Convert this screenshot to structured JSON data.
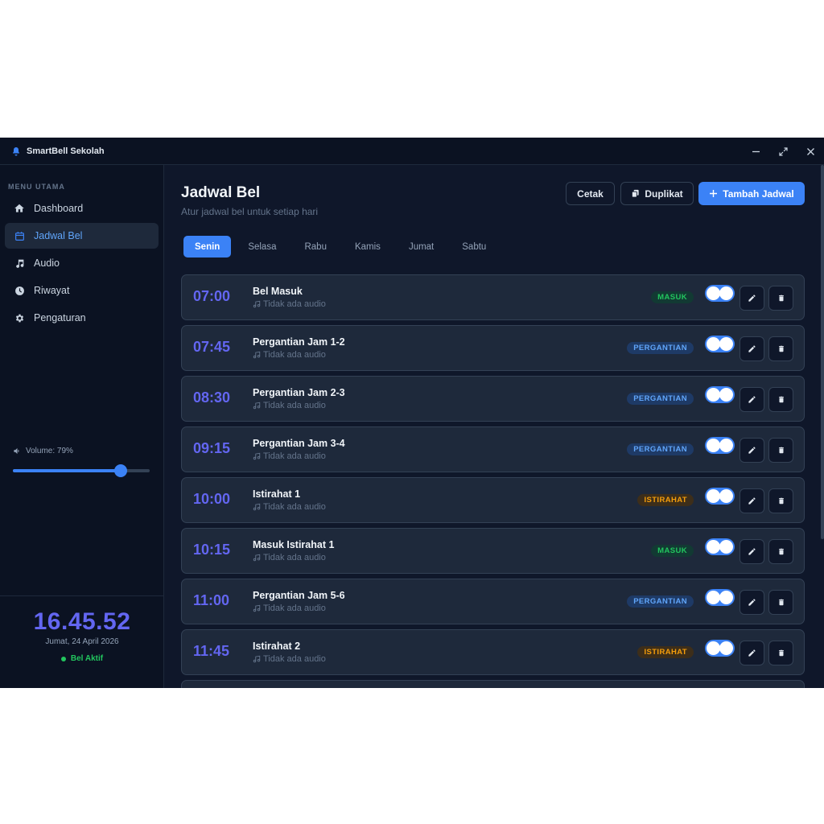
{
  "app": {
    "title": "SmartBell Sekolah"
  },
  "sidebar": {
    "heading": "MENU UTAMA",
    "items": [
      {
        "label": "Dashboard",
        "icon": "home-icon"
      },
      {
        "label": "Jadwal Bel",
        "icon": "calendar-icon",
        "active": true
      },
      {
        "label": "Audio",
        "icon": "music-icon"
      },
      {
        "label": "Riwayat",
        "icon": "clock-icon"
      },
      {
        "label": "Pengaturan",
        "icon": "gear-icon"
      }
    ],
    "volume": {
      "label": "Volume: 79%",
      "value": 79
    },
    "clock": {
      "time": "16.45.52",
      "date": "Jumat, 24 April 2026",
      "status": "Bel Aktif"
    }
  },
  "main": {
    "title": "Jadwal Bel",
    "subtitle": "Atur jadwal bel untuk setiap hari",
    "buttons": {
      "print": "Cetak",
      "duplicate": "Duplikat",
      "add": "Tambah Jadwal"
    },
    "tabs": [
      "Senin",
      "Selasa",
      "Rabu",
      "Kamis",
      "Jumat",
      "Sabtu"
    ],
    "active_tab": "Senin",
    "schedule": [
      {
        "time": "07:00",
        "name": "Bel Masuk",
        "audio": "Tidak ada audio",
        "badge": "MASUK",
        "type": "masuk",
        "enabled": true
      },
      {
        "time": "07:45",
        "name": "Pergantian Jam 1-2",
        "audio": "Tidak ada audio",
        "badge": "PERGANTIAN",
        "type": "pergantian",
        "enabled": true
      },
      {
        "time": "08:30",
        "name": "Pergantian Jam 2-3",
        "audio": "Tidak ada audio",
        "badge": "PERGANTIAN",
        "type": "pergantian",
        "enabled": true
      },
      {
        "time": "09:15",
        "name": "Pergantian Jam 3-4",
        "audio": "Tidak ada audio",
        "badge": "PERGANTIAN",
        "type": "pergantian",
        "enabled": true
      },
      {
        "time": "10:00",
        "name": "Istirahat 1",
        "audio": "Tidak ada audio",
        "badge": "ISTIRAHAT",
        "type": "istirahat",
        "enabled": true
      },
      {
        "time": "10:15",
        "name": "Masuk Istirahat 1",
        "audio": "Tidak ada audio",
        "badge": "MASUK",
        "type": "masuk",
        "enabled": true
      },
      {
        "time": "11:00",
        "name": "Pergantian Jam 5-6",
        "audio": "Tidak ada audio",
        "badge": "PERGANTIAN",
        "type": "pergantian",
        "enabled": true
      },
      {
        "time": "11:45",
        "name": "Istirahat 2",
        "audio": "Tidak ada audio",
        "badge": "ISTIRAHAT",
        "type": "istirahat",
        "enabled": true
      }
    ]
  }
}
